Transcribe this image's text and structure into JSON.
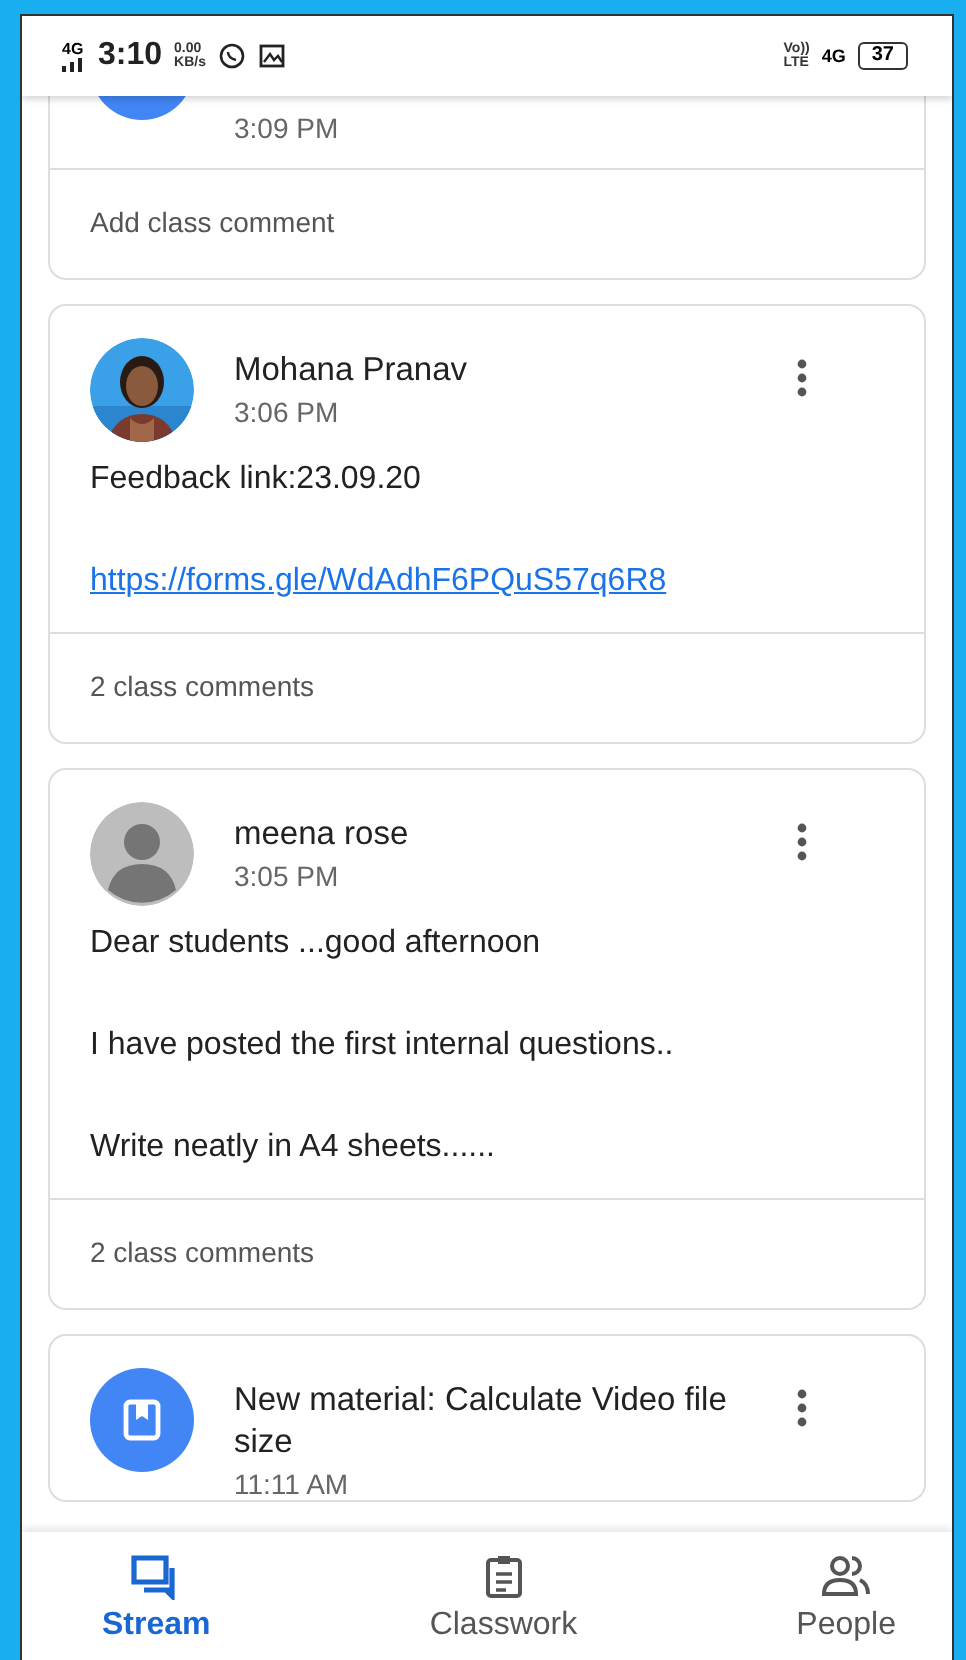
{
  "status_bar": {
    "network": "4G",
    "time": "3:10",
    "speed": "0.00",
    "speed_unit": "KB/s",
    "volte": "Vo))",
    "lte": "LTE",
    "network_right": "4G",
    "battery": "37"
  },
  "posts": [
    {
      "kind": "material",
      "time": "3:09 PM",
      "comments": "Add class comment",
      "has_menu": false
    },
    {
      "author": "Mohana Pranav",
      "time": "3:06 PM",
      "has_menu": true,
      "paragraphs": [
        {
          "text": "Feedback link:23.09.20",
          "link": false
        },
        {
          "text": "https://forms.gle/WdAdhF6PQuS57q6R8",
          "link": true
        }
      ],
      "comments": "2 class comments"
    },
    {
      "kind": "person",
      "author": "meena rose",
      "time": "3:05 PM",
      "has_menu": true,
      "paragraphs": [
        {
          "text": "Dear students ...good afternoon",
          "link": false
        },
        {
          "text": "I have posted the first internal questions..",
          "link": false
        },
        {
          "text": "Write neatly in A4 sheets......",
          "link": false
        }
      ],
      "comments": "2 class comments"
    },
    {
      "kind": "material",
      "author": "New material: Calculate Video file size",
      "time": "11:11 AM",
      "has_menu": true
    }
  ],
  "bottom_nav": [
    {
      "label": "Stream",
      "selected": true
    },
    {
      "label": "Classwork",
      "selected": false
    },
    {
      "label": "People",
      "selected": false
    }
  ]
}
